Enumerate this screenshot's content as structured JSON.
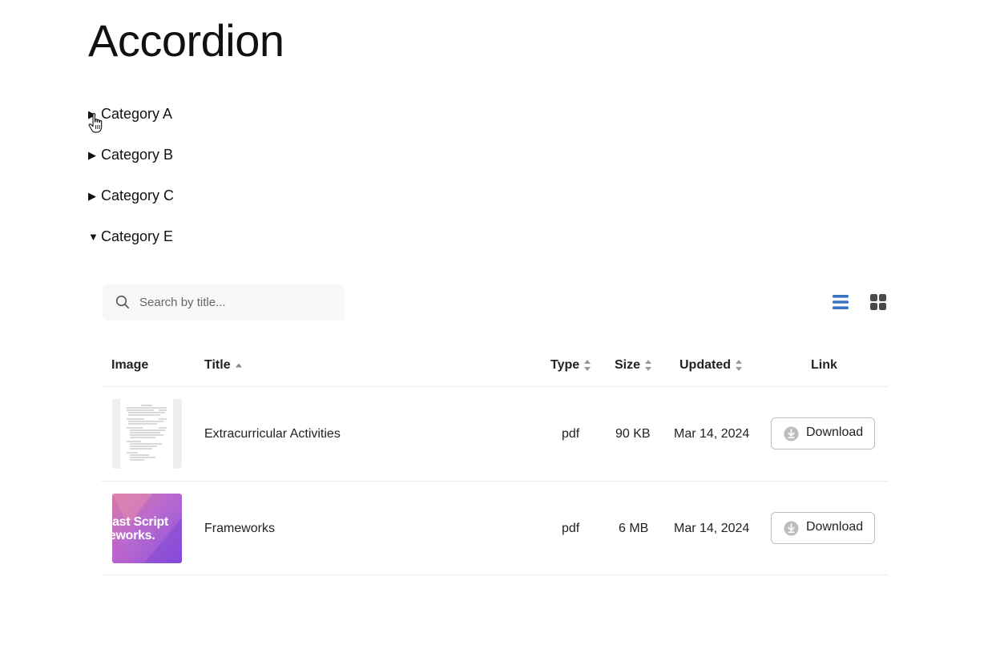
{
  "page": {
    "title": "Accordion"
  },
  "accordion": {
    "items": [
      {
        "label": "Category A",
        "expanded": false
      },
      {
        "label": "Category B",
        "expanded": false
      },
      {
        "label": "Category C",
        "expanded": false
      },
      {
        "label": "Category E",
        "expanded": true
      }
    ]
  },
  "search": {
    "placeholder": "Search by title...",
    "value": ""
  },
  "view_toggle": {
    "active": "list",
    "options": [
      "list",
      "grid"
    ],
    "active_color": "#3b72c4",
    "inactive_color": "#4a4a4a"
  },
  "table": {
    "headers": {
      "image": "Image",
      "title": "Title",
      "type": "Type",
      "size": "Size",
      "updated": "Updated",
      "link": "Link"
    },
    "sort": {
      "column": "title",
      "direction": "ascending"
    },
    "rows": [
      {
        "thumbnail": "document-preview",
        "title": "Extracurricular Activities",
        "type": "pdf",
        "size": "90 KB",
        "updated": "Mar 14, 2024",
        "link_label": "Download"
      },
      {
        "thumbnail": "podcast-cover",
        "thumbnail_text": "dcast Script\nmeworks.",
        "title": "Frameworks",
        "type": "pdf",
        "size": "6 MB",
        "updated": "Mar 14, 2024",
        "link_label": "Download"
      }
    ]
  },
  "icons": {
    "search": "search-icon",
    "list_view": "list-view-icon",
    "grid_view": "grid-view-icon",
    "download": "download-icon",
    "sort": "sort-icon",
    "collapsed": "caret-right-icon",
    "expanded": "caret-down-icon",
    "cursor": "hand-cursor-icon"
  }
}
